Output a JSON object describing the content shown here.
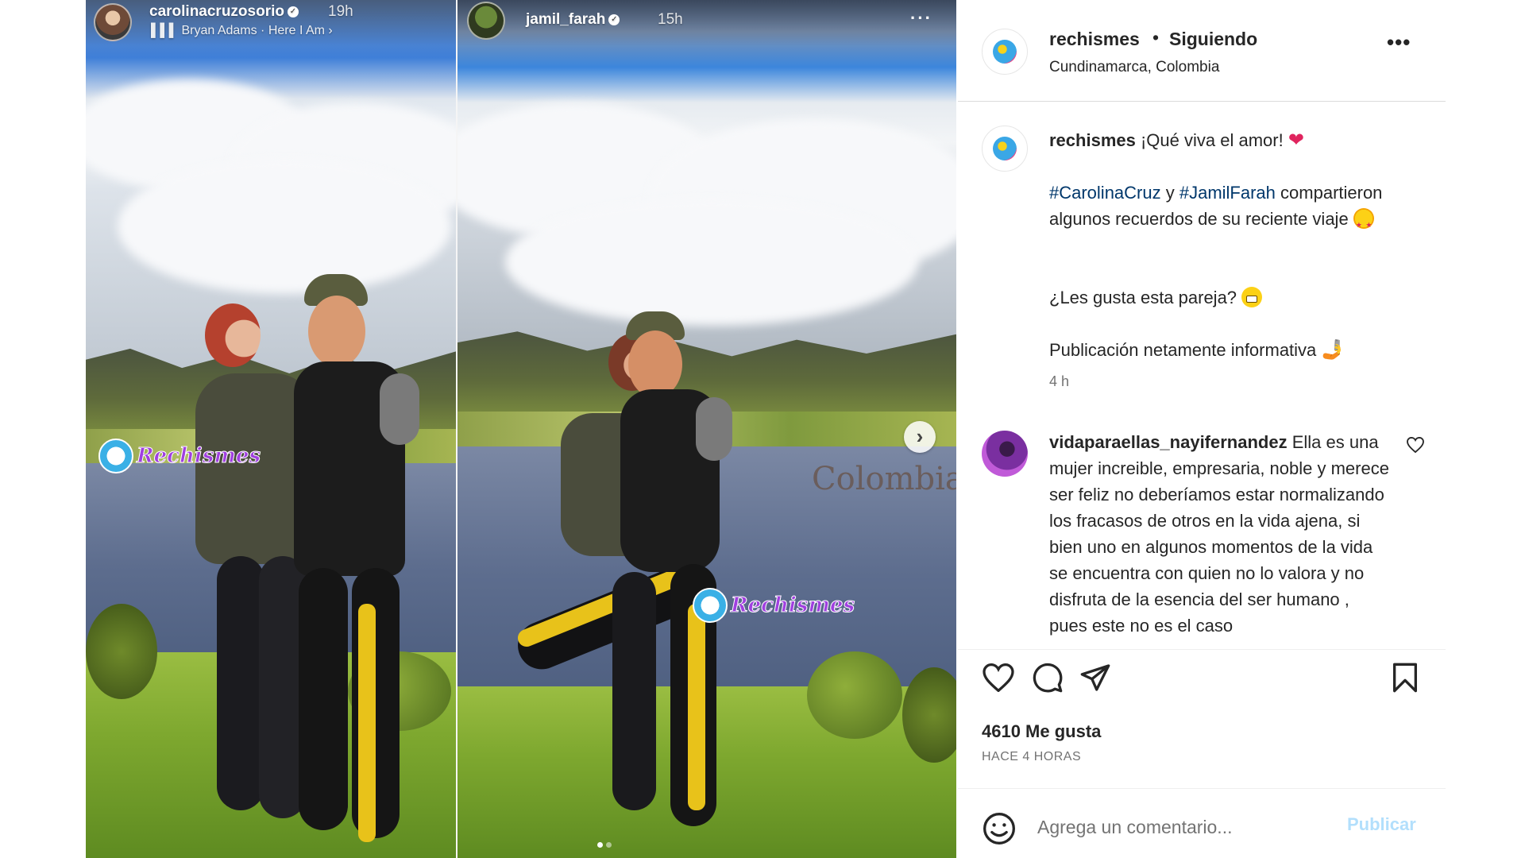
{
  "stories": {
    "left": {
      "username": "carolinacruzosorio",
      "time": "19h",
      "music": "Bryan Adams · Here I Am ›"
    },
    "right": {
      "username": "jamil_farah",
      "time": "15h",
      "overlay_text": "Colombia"
    },
    "watermark": "Rechismes"
  },
  "post": {
    "username": "rechismes",
    "separator": "•",
    "follow_state": "Siguiendo",
    "location": "Cundinamarca, Colombia"
  },
  "caption": {
    "username": "rechismes",
    "line1": "¡Qué viva el amor!",
    "hashtag1": "#CarolinaCruz",
    "connector": " y ",
    "hashtag2": "#JamilFarah",
    "line2": "compartieron algunos recuerdos de su reciente viaje",
    "line3": "¿Les gusta esta pareja?",
    "line4": "Publicación netamente informativa",
    "time": "4 h"
  },
  "comment": {
    "username": "vidaparaellas_nayifernandez",
    "text": "Ella es una mujer increible, empresaria, noble y merece ser feliz no deberíamos estar normalizando los fracasos de otros en la vida ajena, si bien uno en algunos momentos de la vida se encuentra con quien no lo valora y no disfruta de la esencia del ser humano , pues este no es el caso"
  },
  "stats": {
    "likes": "4610 Me gusta",
    "age": "HACE 4 HORAS"
  },
  "add_comment": {
    "placeholder": "Agrega un comentario...",
    "publish_label": "Publicar"
  },
  "icons": {
    "like": "heart-icon",
    "comment": "comment-icon",
    "share": "send-icon",
    "save": "bookmark-icon",
    "emoji": "smiley-icon",
    "more": "more-icon",
    "next": "chevron-right-icon"
  },
  "colors": {
    "hashtag": "#00376b",
    "publish_disabled": "#b2dffc",
    "muted_text": "#737373",
    "watermark": "#a03fe0"
  }
}
